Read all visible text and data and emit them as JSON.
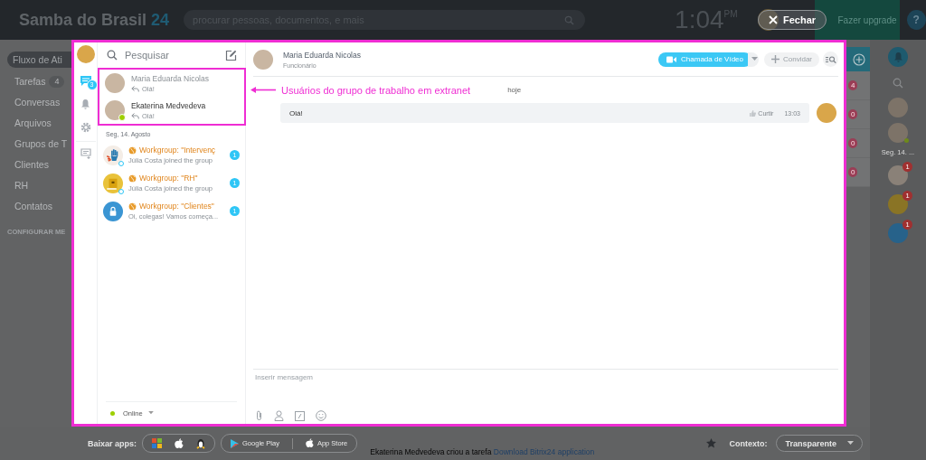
{
  "topbar": {
    "logo": "Samba do Brasil",
    "logo_suffix": "24",
    "search": {
      "placeholder": "procurar pessoas, documentos, e mais"
    },
    "time": "1:04",
    "time_suffix": "PM",
    "close_button": "Fechar",
    "upgrade_button": "Fazer upgrade",
    "help_button": "?"
  },
  "left_menu": {
    "items": [
      {
        "label": "Fluxo de Ati",
        "selected": true
      },
      {
        "label": "Tarefas",
        "count": "4",
        "selected": false
      },
      {
        "label": "Conversas",
        "selected": false
      },
      {
        "label": "Arquivos",
        "selected": false
      },
      {
        "label": "Grupos de T",
        "selected": false
      },
      {
        "label": "Clientes",
        "selected": false
      },
      {
        "label": "RH",
        "selected": false
      },
      {
        "label": "Contatos",
        "selected": false
      }
    ],
    "settings_link": "CONFIGURAR ME"
  },
  "messenger": {
    "rail": [
      {
        "kind": "chats",
        "selected": true,
        "badge": "3"
      },
      {
        "kind": "notifications",
        "selected": false
      },
      {
        "kind": "settings",
        "selected": false
      },
      {
        "kind": "new",
        "selected": false
      }
    ],
    "search": {
      "placeholder": "Pesquisar"
    },
    "recent": [
      {
        "name": "Maria Eduarda Nicolas",
        "preview": "Olá!",
        "online": false,
        "unread": false
      },
      {
        "name": "Ekaterina Medvedeva",
        "preview": "Olá!",
        "online": true,
        "unread": true
      }
    ],
    "date_divider": "Seg, 14. Agosto",
    "groups": [
      {
        "kind": "hands",
        "title": "Workgroup: \"Intervenç",
        "preview": "Júlia Costa joined the group",
        "counter": "1"
      },
      {
        "kind": "folder",
        "title": "Workgroup: \"RH\"",
        "preview": "Júlia Costa joined the group",
        "counter": "1"
      },
      {
        "kind": "lock",
        "title": "Workgroup: \"Clientes\"",
        "preview": "Oi, colegas! Vamos começa...",
        "counter": "1"
      }
    ],
    "status": "Online",
    "chat": {
      "name": "Maria Eduarda Nicolas",
      "position": "Funcionário",
      "video_button": "Chamada de Vídeo",
      "invite_button": "Convidar",
      "annotation": "Usuários do grupo de trabalho em extranet",
      "day": "hoje",
      "messages": [
        {
          "text": "Olá!",
          "like": "Curtir",
          "time": "13:03"
        }
      ],
      "input": {
        "placeholder": "Inserir mensagem"
      }
    }
  },
  "right_column": {
    "counters": [
      "4",
      "0",
      "0",
      "0"
    ]
  },
  "right_bar": {
    "date": "Seg. 14. ...",
    "contacts": [
      {
        "kind": "photo",
        "online": false
      },
      {
        "kind": "photo",
        "online": true
      }
    ],
    "groups": [
      {
        "kind": "hands",
        "counter": "1"
      },
      {
        "kind": "folder",
        "counter": "1"
      },
      {
        "kind": "lock",
        "counter": "1"
      }
    ]
  },
  "footer": {
    "apps_label": "Baixar apps:",
    "store_buttons": [
      "Google Play",
      "App Store"
    ],
    "feed_text": "Ekaterina Medvedeva criou a tarefa",
    "feed_link": "Download Bitrix24 application",
    "context_label": "Contexto:",
    "context_value": "Transparente"
  }
}
